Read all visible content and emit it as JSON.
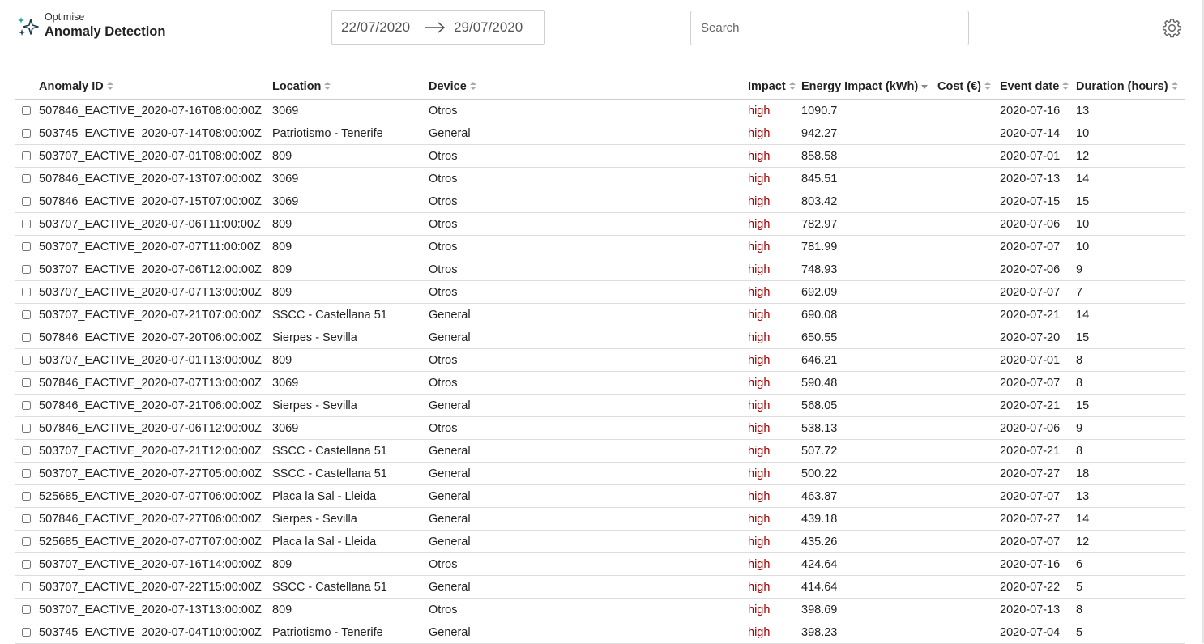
{
  "header": {
    "brand_subtitle": "Optimise",
    "brand_title": "Anomaly Detection",
    "logo_icon": "sparkle-icon",
    "date_from": "22/07/2020",
    "date_to": "29/07/2020",
    "search_placeholder": "Search",
    "settings_icon": "gear-icon"
  },
  "colors": {
    "impact_high": "#a40000",
    "border": "#dddddd"
  },
  "table": {
    "columns": [
      {
        "label": "Anomaly ID",
        "sort": "none"
      },
      {
        "label": "Location",
        "sort": "none"
      },
      {
        "label": "Device",
        "sort": "none"
      },
      {
        "label": "Impact",
        "sort": "none"
      },
      {
        "label": "Energy Impact (kWh)",
        "sort": "desc"
      },
      {
        "label": "Cost (€)",
        "sort": "none"
      },
      {
        "label": "Event date",
        "sort": "none"
      },
      {
        "label": "Duration (hours)",
        "sort": "none"
      }
    ],
    "rows": [
      {
        "id": "507846_EACTIVE_2020-07-16T08:00:00Z",
        "location": "3069",
        "device": "Otros",
        "impact": "high",
        "energy": "1090.7",
        "cost": "",
        "date": "2020-07-16",
        "duration": "13"
      },
      {
        "id": "503745_EACTIVE_2020-07-14T08:00:00Z",
        "location": "Patriotismo - Tenerife",
        "device": "General",
        "impact": "high",
        "energy": "942.27",
        "cost": "",
        "date": "2020-07-14",
        "duration": "10"
      },
      {
        "id": "503707_EACTIVE_2020-07-01T08:00:00Z",
        "location": "809",
        "device": "Otros",
        "impact": "high",
        "energy": "858.58",
        "cost": "",
        "date": "2020-07-01",
        "duration": "12"
      },
      {
        "id": "507846_EACTIVE_2020-07-13T07:00:00Z",
        "location": "3069",
        "device": "Otros",
        "impact": "high",
        "energy": "845.51",
        "cost": "",
        "date": "2020-07-13",
        "duration": "14"
      },
      {
        "id": "507846_EACTIVE_2020-07-15T07:00:00Z",
        "location": "3069",
        "device": "Otros",
        "impact": "high",
        "energy": "803.42",
        "cost": "",
        "date": "2020-07-15",
        "duration": "15"
      },
      {
        "id": "503707_EACTIVE_2020-07-06T11:00:00Z",
        "location": "809",
        "device": "Otros",
        "impact": "high",
        "energy": "782.97",
        "cost": "",
        "date": "2020-07-06",
        "duration": "10"
      },
      {
        "id": "503707_EACTIVE_2020-07-07T11:00:00Z",
        "location": "809",
        "device": "Otros",
        "impact": "high",
        "energy": "781.99",
        "cost": "",
        "date": "2020-07-07",
        "duration": "10"
      },
      {
        "id": "503707_EACTIVE_2020-07-06T12:00:00Z",
        "location": "809",
        "device": "Otros",
        "impact": "high",
        "energy": "748.93",
        "cost": "",
        "date": "2020-07-06",
        "duration": "9"
      },
      {
        "id": "503707_EACTIVE_2020-07-07T13:00:00Z",
        "location": "809",
        "device": "Otros",
        "impact": "high",
        "energy": "692.09",
        "cost": "",
        "date": "2020-07-07",
        "duration": "7"
      },
      {
        "id": "503707_EACTIVE_2020-07-21T07:00:00Z",
        "location": "SSCC - Castellana 51",
        "device": "General",
        "impact": "high",
        "energy": "690.08",
        "cost": "",
        "date": "2020-07-21",
        "duration": "14"
      },
      {
        "id": "507846_EACTIVE_2020-07-20T06:00:00Z",
        "location": "Sierpes - Sevilla",
        "device": "General",
        "impact": "high",
        "energy": "650.55",
        "cost": "",
        "date": "2020-07-20",
        "duration": "15"
      },
      {
        "id": "503707_EACTIVE_2020-07-01T13:00:00Z",
        "location": "809",
        "device": "Otros",
        "impact": "high",
        "energy": "646.21",
        "cost": "",
        "date": "2020-07-01",
        "duration": "8"
      },
      {
        "id": "507846_EACTIVE_2020-07-07T13:00:00Z",
        "location": "3069",
        "device": "Otros",
        "impact": "high",
        "energy": "590.48",
        "cost": "",
        "date": "2020-07-07",
        "duration": "8"
      },
      {
        "id": "507846_EACTIVE_2020-07-21T06:00:00Z",
        "location": "Sierpes - Sevilla",
        "device": "General",
        "impact": "high",
        "energy": "568.05",
        "cost": "",
        "date": "2020-07-21",
        "duration": "15"
      },
      {
        "id": "507846_EACTIVE_2020-07-06T12:00:00Z",
        "location": "3069",
        "device": "Otros",
        "impact": "high",
        "energy": "538.13",
        "cost": "",
        "date": "2020-07-06",
        "duration": "9"
      },
      {
        "id": "503707_EACTIVE_2020-07-21T12:00:00Z",
        "location": "SSCC - Castellana 51",
        "device": "General",
        "impact": "high",
        "energy": "507.72",
        "cost": "",
        "date": "2020-07-21",
        "duration": "8"
      },
      {
        "id": "503707_EACTIVE_2020-07-27T05:00:00Z",
        "location": "SSCC - Castellana 51",
        "device": "General",
        "impact": "high",
        "energy": "500.22",
        "cost": "",
        "date": "2020-07-27",
        "duration": "18"
      },
      {
        "id": "525685_EACTIVE_2020-07-07T06:00:00Z",
        "location": "Placa la Sal - Lleida",
        "device": "General",
        "impact": "high",
        "energy": "463.87",
        "cost": "",
        "date": "2020-07-07",
        "duration": "13"
      },
      {
        "id": "507846_EACTIVE_2020-07-27T06:00:00Z",
        "location": "Sierpes - Sevilla",
        "device": "General",
        "impact": "high",
        "energy": "439.18",
        "cost": "",
        "date": "2020-07-27",
        "duration": "14"
      },
      {
        "id": "525685_EACTIVE_2020-07-07T07:00:00Z",
        "location": "Placa la Sal - Lleida",
        "device": "General",
        "impact": "high",
        "energy": "435.26",
        "cost": "",
        "date": "2020-07-07",
        "duration": "12"
      },
      {
        "id": "503707_EACTIVE_2020-07-16T14:00:00Z",
        "location": "809",
        "device": "Otros",
        "impact": "high",
        "energy": "424.64",
        "cost": "",
        "date": "2020-07-16",
        "duration": "6"
      },
      {
        "id": "503707_EACTIVE_2020-07-22T15:00:00Z",
        "location": "SSCC - Castellana 51",
        "device": "General",
        "impact": "high",
        "energy": "414.64",
        "cost": "",
        "date": "2020-07-22",
        "duration": "5"
      },
      {
        "id": "503707_EACTIVE_2020-07-13T13:00:00Z",
        "location": "809",
        "device": "Otros",
        "impact": "high",
        "energy": "398.69",
        "cost": "",
        "date": "2020-07-13",
        "duration": "8"
      },
      {
        "id": "503745_EACTIVE_2020-07-04T10:00:00Z",
        "location": "Patriotismo - Tenerife",
        "device": "General",
        "impact": "high",
        "energy": "398.23",
        "cost": "",
        "date": "2020-07-04",
        "duration": "5"
      }
    ]
  }
}
